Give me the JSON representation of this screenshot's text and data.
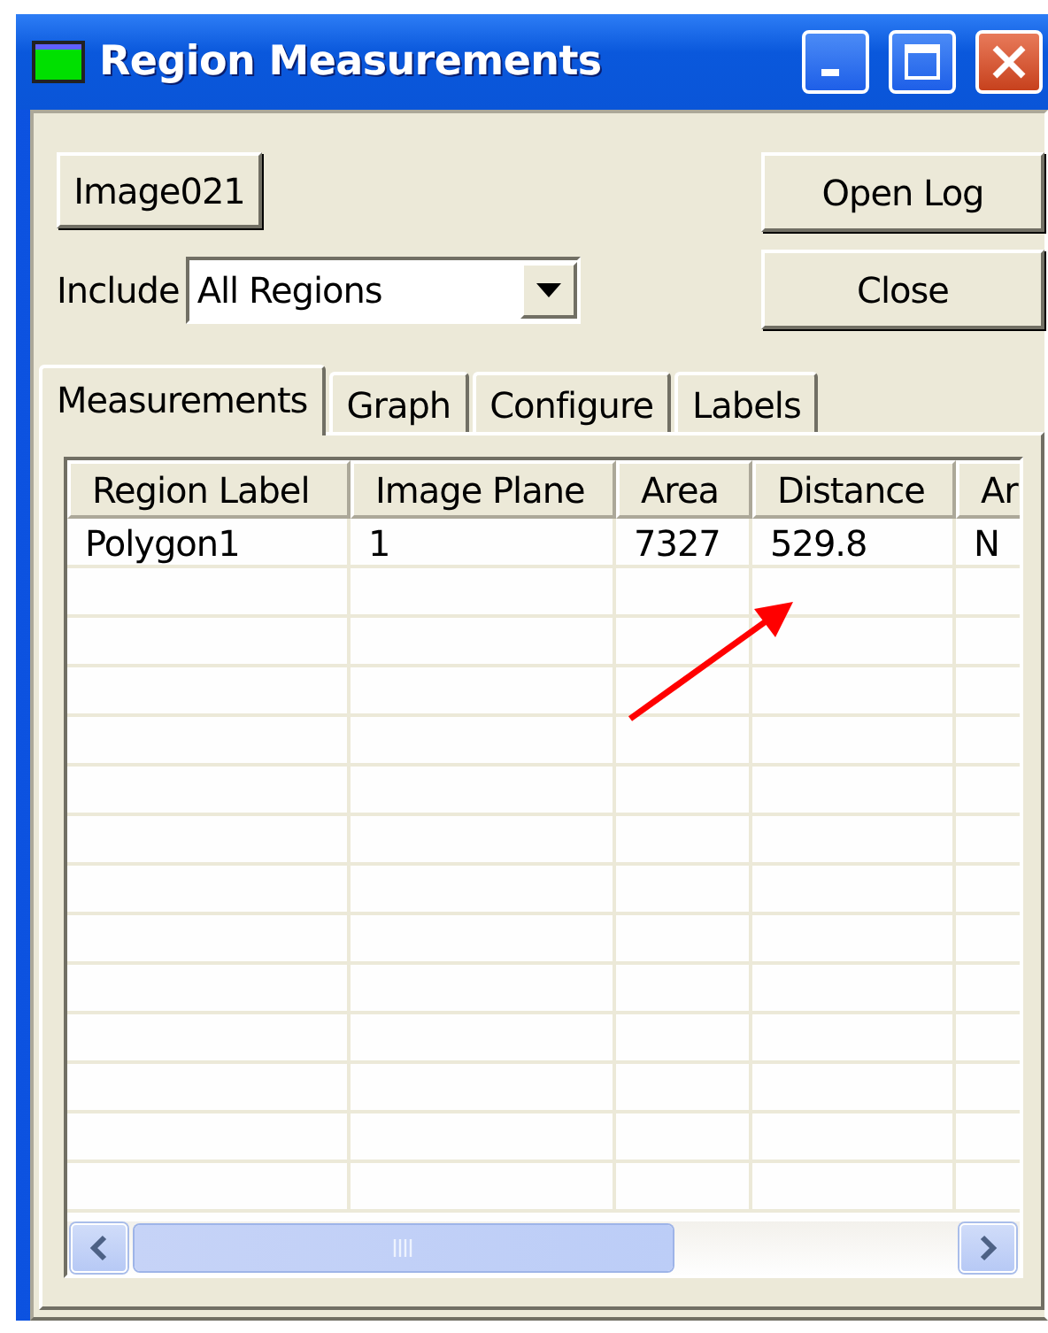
{
  "window": {
    "title": "Region Measurements"
  },
  "image_button": "Image021",
  "include": {
    "label": "Include",
    "value": "All Regions"
  },
  "buttons": [
    "Open Log",
    "Close"
  ],
  "tabs": [
    {
      "label": "Measurements",
      "selected": true
    },
    {
      "label": "Graph",
      "selected": false
    },
    {
      "label": "Configure",
      "selected": false
    },
    {
      "label": "Labels",
      "selected": false
    }
  ],
  "table": {
    "columns": [
      "Region Label",
      "Image Plane",
      "Area",
      "Distance",
      "Ar"
    ],
    "rows": [
      [
        "Polygon1",
        "1",
        "7327",
        "529.8",
        "N"
      ]
    ]
  }
}
